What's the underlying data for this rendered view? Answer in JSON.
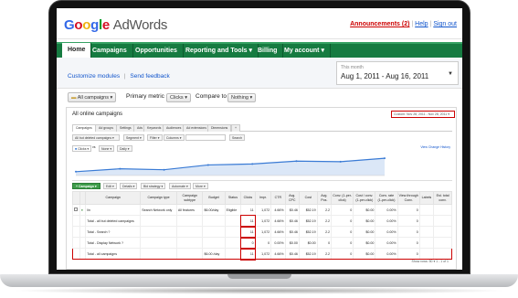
{
  "header": {
    "logo_google": "Google",
    "logo_product": "AdWords",
    "announcements": "Announcements (2)",
    "help": "Help",
    "sign_out": "Sign out",
    "sep": "|"
  },
  "nav": {
    "tabs": [
      {
        "label": "Home",
        "active": true
      },
      {
        "label": "Campaigns"
      },
      {
        "label": "Opportunities"
      },
      {
        "label": "Reporting and Tools ▾"
      },
      {
        "label": "Billing"
      },
      {
        "label": "My account ▾"
      }
    ]
  },
  "subheader": {
    "customize": "Customize modules",
    "sep": "|",
    "feedback": "Send feedback",
    "date_label": "This month",
    "date_range": "Aug 1, 2011 - Aug 16, 2011"
  },
  "controls": {
    "all_campaigns": "All campaigns",
    "primary_metric_label": "Primary metric",
    "primary_metric_value": "Clicks",
    "compare_label": "Compare to",
    "compare_value": "Nothing"
  },
  "card": {
    "title": "All online campaigns",
    "date_range": "Custom: Nov 28, 2011 - Nov 28, 2011",
    "tabs": [
      "Campaigns",
      "Ad groups",
      "Settings",
      "Ads",
      "Keywords",
      "Audiences",
      "Ad extensions",
      "Dimensions",
      "+"
    ],
    "filters": [
      "All but deleted campaigns ▾",
      "Segment ▾",
      "Filter ▾",
      "Columns ▾",
      "",
      "Search"
    ],
    "chart_ctl": [
      "Clicks ▾",
      "vs",
      "None ▾",
      "Daily ▾"
    ],
    "change_history": "View Change History",
    "toolbar": [
      "+ Campaign ▾",
      "Edit ▾",
      "Details ▾",
      "Bid strategy ▾",
      "Automate ▾",
      "More ▾"
    ],
    "pager": "Show rows: 50 ▾   1 - 1 of 1"
  },
  "table": {
    "headers": [
      "",
      "",
      "Campaign",
      "Campaign type",
      "Campaign subtype",
      "Budget",
      "Status",
      "Clicks",
      "Impr.",
      "CTR",
      "Avg. CPC",
      "Cost",
      "Avg. Pos.",
      "Conv. (1-per-click)",
      "Cost / conv. (1-per-click)",
      "Conv. rate (1-per-click)",
      "View-through Conv.",
      "Labels",
      "Est. total conv."
    ],
    "rows": [
      {
        "cells": [
          "",
          "●",
          "lin",
          "Search Network only",
          "All features",
          "$6.00/day",
          "Eligible",
          "11",
          "1,072",
          "4.66%",
          "$0.46",
          "$52.19",
          "2.2",
          "0",
          "$0.00",
          "0.00%",
          "0",
          "",
          ""
        ]
      },
      {
        "cells": [
          "",
          "",
          "Total - all but deleted campaigns",
          "",
          "",
          "",
          "",
          "11",
          "1,072",
          "4.66%",
          "$0.46",
          "$52.19",
          "2.2",
          "0",
          "$0.00",
          "0.00%",
          "0",
          "",
          ""
        ]
      },
      {
        "cells": [
          "",
          "",
          "Total - Search ?",
          "",
          "",
          "",
          "",
          "11",
          "1,072",
          "4.66%",
          "$0.46",
          "$52.19",
          "2.2",
          "0",
          "$0.00",
          "0.00%",
          "0",
          "",
          ""
        ]
      },
      {
        "cells": [
          "",
          "",
          "Total - Display Network ?",
          "",
          "",
          "",
          "",
          "0",
          "0",
          "0.00%",
          "$0.00",
          "$0.00",
          "0",
          "0",
          "$0.00",
          "0.00%",
          "0",
          "",
          ""
        ]
      },
      {
        "cells": [
          "",
          "",
          "Total - all campaigns",
          "",
          "",
          "$6.00 /day",
          "",
          "11",
          "1,072",
          "4.66%",
          "$0.46",
          "$52.19",
          "2.2",
          "0",
          "$0.00",
          "0.00%",
          "0",
          "",
          ""
        ]
      }
    ]
  },
  "chart_data": {
    "type": "line",
    "values": [
      0.2,
      0.35,
      0.3,
      0.55,
      0.6,
      0.75,
      0.72,
      0.9
    ]
  }
}
